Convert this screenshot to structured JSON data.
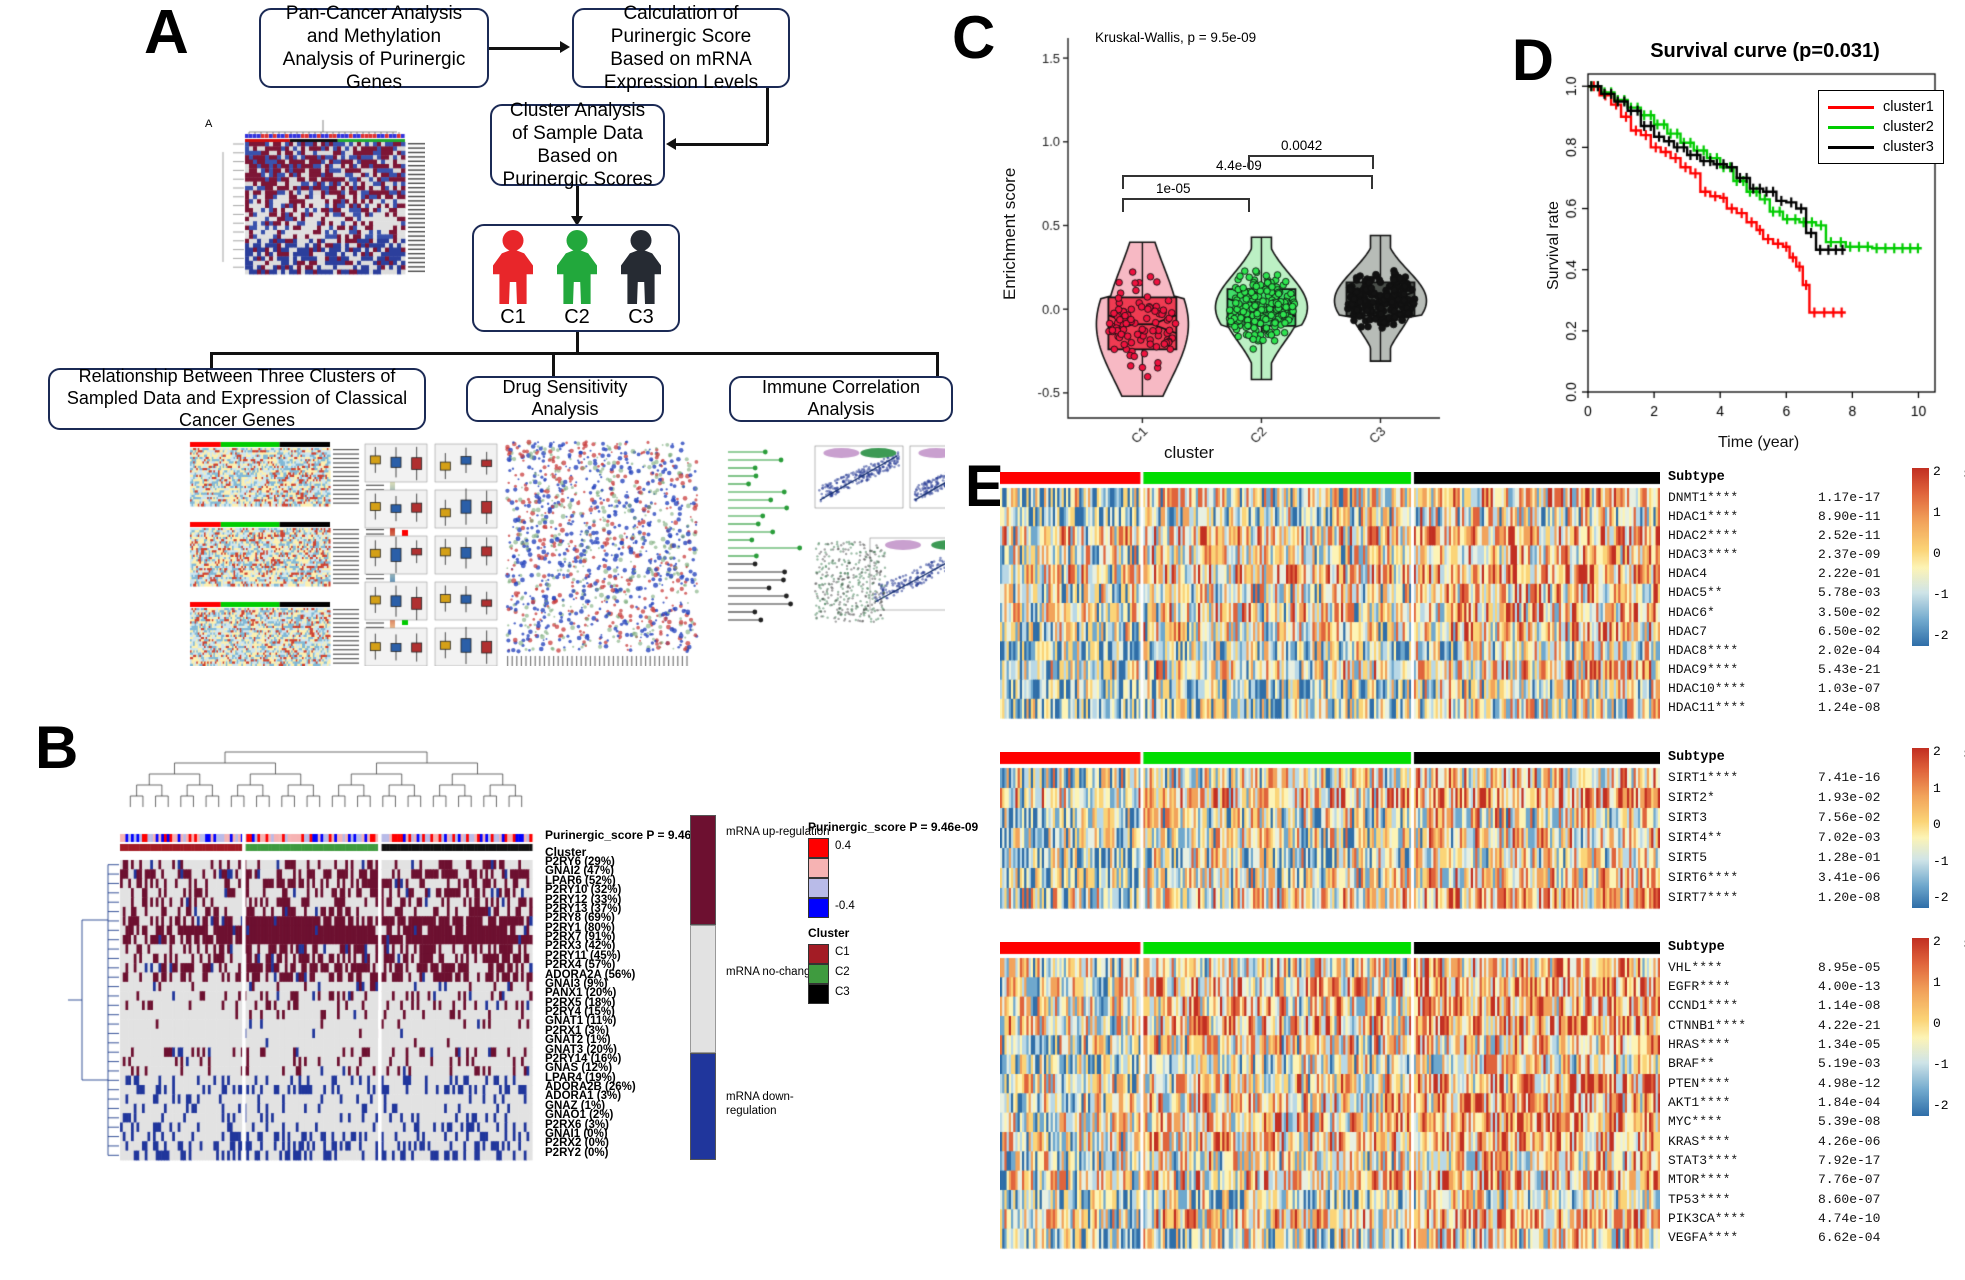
{
  "panels": {
    "a": "A",
    "b": "B",
    "c": "C",
    "d": "D",
    "e": "E"
  },
  "flowchart": {
    "boxes": [
      {
        "id": "box1",
        "text": "Pan-Cancer Analysis and Methylation Analysis of Purinergic Genes"
      },
      {
        "id": "box2",
        "text": "Calculation of Purinergic Score Based on mRNA Expression Levels"
      },
      {
        "id": "box3",
        "text": "Cluster Analysis of Sample Data Based on Purinergic Scores"
      },
      {
        "id": "box5",
        "text": "Relationship Between Three Clusters of Sampled Data and Expression of Classical Cancer Genes"
      },
      {
        "id": "box6",
        "text": "Drug Sensitivity Analysis"
      },
      {
        "id": "box7",
        "text": "Immune Correlation Analysis"
      }
    ],
    "clusters": [
      {
        "label": "C1",
        "color": "#e8262a"
      },
      {
        "label": "C2",
        "color": "#22a83c"
      },
      {
        "label": "C3",
        "color": "#262b33"
      }
    ],
    "thumb_label": "A"
  },
  "panel_b": {
    "legend_title": "Purinergic_score P = 9.46e-09",
    "row_annots": [
      "Purinergic_score P = 9.46e-09",
      "Cluster"
    ],
    "genes": [
      "P2RY6 (29%)",
      "GNAI2 (47%)",
      "LPAR6 (52%)",
      "P2RY10 (32%)",
      "P2RY12 (33%)",
      "P2RY13 (37%)",
      "P2RY8 (69%)",
      "P2RY1 (80%)",
      "P2RX7 (91%)",
      "P2RX3 (42%)",
      "P2RY11 (45%)",
      "P2RX4 (57%)",
      "ADORA2A (56%)",
      "GNAI3 (9%)",
      "PANX1 (20%)",
      "P2RX5 (18%)",
      "P2RY4 (15%)",
      "GNAT1 (11%)",
      "P2RX1 (3%)",
      "GNAT2 (1%)",
      "GNAT3 (20%)",
      "P2RY14 (16%)",
      "GNAS (12%)",
      "LPAR4 (19%)",
      "ADORA2B (26%)",
      "ADORA1 (3%)",
      "GNAZ (1%)",
      "GNAO1 (2%)",
      "P2RX6 (3%)",
      "GNAI1 (0%)",
      "P2RX2 (0%)",
      "P2RY2 (0%)"
    ],
    "mrna_legend": [
      {
        "label": "mRNA up-regulation",
        "color": "#6d1030"
      },
      {
        "label": "mRNA no-change",
        "color": "#e2e2e2"
      },
      {
        "label": "mRNA down-regulation",
        "color": "#20369c"
      }
    ],
    "score_legend": {
      "title": "Purinergic_score P = 9.46e-09",
      "max": "0.4",
      "min": "-0.4",
      "colors": [
        "#ff0000",
        "#f6b3b3",
        "#b9bbe8",
        "#0000ff"
      ]
    },
    "cluster_legend": {
      "title": "Cluster",
      "items": [
        {
          "label": "C1",
          "color": "#a31c25"
        },
        {
          "label": "C2",
          "color": "#3f9b3f"
        },
        {
          "label": "C3",
          "color": "#000000"
        }
      ]
    }
  },
  "chart_data": [
    {
      "id": "panel_c",
      "type": "violin",
      "title": "",
      "annotation": "Kruskal-Wallis, p = 9.5e-09",
      "xlabel": "cluster",
      "ylabel": "Enrichment score",
      "categories": [
        "C1",
        "C2",
        "C3"
      ],
      "ylim": [
        -0.65,
        1.62
      ],
      "yticks": [
        -0.5,
        0.0,
        0.5,
        1.0,
        1.5
      ],
      "ytick_labels": [
        "-0.5",
        "0.0",
        "0.5",
        "1.0",
        "1.5"
      ],
      "groups": [
        {
          "name": "C1",
          "color": "#ef3b52",
          "fill_light": "#f7b9c4",
          "median": -0.09,
          "q1": -0.24,
          "q3": 0.07,
          "whisker_low": -0.52,
          "whisker_high": 0.4,
          "n": 100
        },
        {
          "name": "C2",
          "color": "#3fdd68",
          "fill_light": "#bcf0c4",
          "median": 0.01,
          "q1": -0.1,
          "q3": 0.12,
          "whisker_low": -0.42,
          "whisker_high": 0.43,
          "n": 200
        },
        {
          "name": "C3",
          "color": "#4a4f4a",
          "fill_light": "#b7bcb7",
          "median": 0.05,
          "q1": -0.04,
          "q3": 0.16,
          "whisker_low": -0.31,
          "whisker_high": 0.44,
          "n": 190
        }
      ],
      "comparisons": [
        {
          "pair": [
            "C1",
            "C2"
          ],
          "label": "1e-05"
        },
        {
          "pair": [
            "C1",
            "C3"
          ],
          "label": "4.4e-09"
        },
        {
          "pair": [
            "C2",
            "C3"
          ],
          "label": "0.0042"
        }
      ]
    },
    {
      "id": "panel_d",
      "type": "line",
      "title": "Survival curve (p=0.031)",
      "xlabel": "Time (year)",
      "ylabel": "Survival rate",
      "xlim": [
        0,
        10.5
      ],
      "ylim": [
        0,
        1.04
      ],
      "xticks": [
        0,
        2,
        4,
        6,
        8,
        10
      ],
      "yticks": [
        0.0,
        0.2,
        0.4,
        0.6,
        0.8,
        1.0
      ],
      "xtick_labels": [
        "0",
        "2",
        "4",
        "6",
        "8",
        "10"
      ],
      "ytick_labels": [
        "0.0",
        "0.2",
        "0.4",
        "0.6",
        "0.8",
        "1.0"
      ],
      "legend_position": "top-right",
      "series": [
        {
          "name": "cluster1",
          "color": "#ff0000",
          "points": [
            [
              0,
              1.0
            ],
            [
              0.35,
              0.97
            ],
            [
              0.7,
              0.94
            ],
            [
              1.0,
              0.9
            ],
            [
              1.3,
              0.855
            ],
            [
              1.6,
              0.84
            ],
            [
              1.9,
              0.8
            ],
            [
              2.2,
              0.785
            ],
            [
              2.5,
              0.765
            ],
            [
              2.8,
              0.735
            ],
            [
              3.1,
              0.715
            ],
            [
              3.4,
              0.655
            ],
            [
              3.7,
              0.64
            ],
            [
              4.0,
              0.635
            ],
            [
              4.2,
              0.6
            ],
            [
              4.5,
              0.585
            ],
            [
              4.8,
              0.555
            ],
            [
              5.1,
              0.53
            ],
            [
              5.3,
              0.5
            ],
            [
              5.6,
              0.485
            ],
            [
              5.9,
              0.475
            ],
            [
              6.1,
              0.44
            ],
            [
              6.3,
              0.41
            ],
            [
              6.5,
              0.35
            ],
            [
              6.7,
              0.26
            ],
            [
              7.3,
              0.26
            ],
            [
              7.8,
              0.26
            ]
          ]
        },
        {
          "name": "cluster2",
          "color": "#00cc00",
          "points": [
            [
              0,
              1.0
            ],
            [
              0.4,
              0.98
            ],
            [
              0.8,
              0.955
            ],
            [
              1.2,
              0.93
            ],
            [
              1.6,
              0.905
            ],
            [
              2.0,
              0.875
            ],
            [
              2.4,
              0.845
            ],
            [
              2.8,
              0.815
            ],
            [
              3.2,
              0.79
            ],
            [
              3.6,
              0.765
            ],
            [
              4.0,
              0.735
            ],
            [
              4.4,
              0.69
            ],
            [
              4.8,
              0.655
            ],
            [
              5.2,
              0.63
            ],
            [
              5.5,
              0.59
            ],
            [
              5.9,
              0.565
            ],
            [
              6.4,
              0.555
            ],
            [
              6.9,
              0.545
            ],
            [
              7.2,
              0.49
            ],
            [
              7.8,
              0.475
            ],
            [
              8.6,
              0.47
            ],
            [
              9.4,
              0.47
            ],
            [
              10.1,
              0.47
            ]
          ]
        },
        {
          "name": "cluster3",
          "color": "#000000",
          "points": [
            [
              0,
              1.0
            ],
            [
              0.4,
              0.975
            ],
            [
              0.8,
              0.95
            ],
            [
              1.2,
              0.92
            ],
            [
              1.6,
              0.87
            ],
            [
              2.0,
              0.835
            ],
            [
              2.3,
              0.82
            ],
            [
              2.6,
              0.8
            ],
            [
              3.0,
              0.775
            ],
            [
              3.4,
              0.755
            ],
            [
              3.8,
              0.745
            ],
            [
              4.2,
              0.735
            ],
            [
              4.5,
              0.7
            ],
            [
              4.9,
              0.665
            ],
            [
              5.3,
              0.655
            ],
            [
              5.7,
              0.625
            ],
            [
              6.0,
              0.62
            ],
            [
              6.3,
              0.6
            ],
            [
              6.6,
              0.52
            ],
            [
              6.9,
              0.465
            ],
            [
              7.4,
              0.465
            ],
            [
              7.8,
              0.465
            ]
          ]
        }
      ]
    }
  ],
  "panel_e": {
    "subtype_label": "Subtype",
    "legend_title": "Subtype",
    "legend_items": [
      {
        "label": "cluster1",
        "color": "#ff0000"
      },
      {
        "label": "cluster2",
        "color": "#00dd00"
      },
      {
        "label": "cluster3",
        "color": "#000000"
      }
    ],
    "colorbar_ticks": [
      "2",
      "1",
      "0",
      "-1",
      "-2"
    ],
    "heatmaps": [
      {
        "id": "heatmap-hdac",
        "rows": [
          {
            "gene": "DNMT1****",
            "p": "1.17e-17"
          },
          {
            "gene": "HDAC1****",
            "p": "8.90e-11"
          },
          {
            "gene": "HDAC2****",
            "p": "2.52e-11"
          },
          {
            "gene": "HDAC3****",
            "p": "2.37e-09"
          },
          {
            "gene": "HDAC4",
            "p": "2.22e-01"
          },
          {
            "gene": "HDAC5**",
            "p": "5.78e-03"
          },
          {
            "gene": "HDAC6*",
            "p": "3.50e-02"
          },
          {
            "gene": "HDAC7",
            "p": "6.50e-02"
          },
          {
            "gene": "HDAC8****",
            "p": "2.02e-04"
          },
          {
            "gene": "HDAC9****",
            "p": "5.43e-21"
          },
          {
            "gene": "HDAC10****",
            "p": "1.03e-07"
          },
          {
            "gene": "HDAC11****",
            "p": "1.24e-08"
          }
        ]
      },
      {
        "id": "heatmap-sirt",
        "rows": [
          {
            "gene": "SIRT1****",
            "p": "7.41e-16"
          },
          {
            "gene": "SIRT2*",
            "p": "1.93e-02"
          },
          {
            "gene": "SIRT3",
            "p": "7.56e-02"
          },
          {
            "gene": "SIRT4**",
            "p": "7.02e-03"
          },
          {
            "gene": "SIRT5",
            "p": "1.28e-01"
          },
          {
            "gene": "SIRT6****",
            "p": "3.41e-06"
          },
          {
            "gene": "SIRT7****",
            "p": "1.20e-08"
          }
        ]
      },
      {
        "id": "heatmap-cancer-genes",
        "rows": [
          {
            "gene": "VHL****",
            "p": "8.95e-05"
          },
          {
            "gene": "EGFR****",
            "p": "4.00e-13"
          },
          {
            "gene": "CCND1****",
            "p": "1.14e-08"
          },
          {
            "gene": "CTNNB1****",
            "p": "4.22e-21"
          },
          {
            "gene": "HRAS****",
            "p": "1.34e-05"
          },
          {
            "gene": "BRAF**",
            "p": "5.19e-03"
          },
          {
            "gene": "PTEN****",
            "p": "4.98e-12"
          },
          {
            "gene": "AKT1****",
            "p": "1.84e-04"
          },
          {
            "gene": "MYC****",
            "p": "5.39e-08"
          },
          {
            "gene": "KRAS****",
            "p": "4.26e-06"
          },
          {
            "gene": "STAT3****",
            "p": "7.92e-17"
          },
          {
            "gene": "MTOR****",
            "p": "7.76e-07"
          },
          {
            "gene": "TP53****",
            "p": "8.60e-07"
          },
          {
            "gene": "PIK3CA****",
            "p": "4.74e-10"
          },
          {
            "gene": "VEGFA****",
            "p": "6.62e-04"
          }
        ]
      }
    ]
  },
  "colors": {
    "cluster1": "#ff0000",
    "cluster2": "#00dd00",
    "cluster3": "#000000",
    "box_border": "#1b2a55"
  }
}
